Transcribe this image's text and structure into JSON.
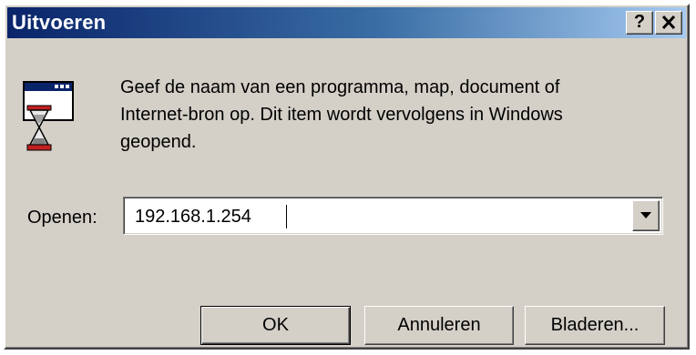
{
  "window": {
    "title": "Uitvoeren",
    "help_label": "?",
    "close_label": "✕"
  },
  "icon": "run-program-icon",
  "description": "Geef de naam van een programma, map, document of\nInternet-bron op. Dit item wordt vervolgens in Windows\ngeopend.",
  "open_field": {
    "label": "Openen:",
    "value": "192.168.1.254"
  },
  "buttons": {
    "ok": "OK",
    "cancel": "Annuleren",
    "browse": "Bladeren..."
  },
  "colors": {
    "titlebar_start": "#0a246a",
    "titlebar_end": "#a6caf0",
    "dialog_face": "#d4d0c8"
  }
}
